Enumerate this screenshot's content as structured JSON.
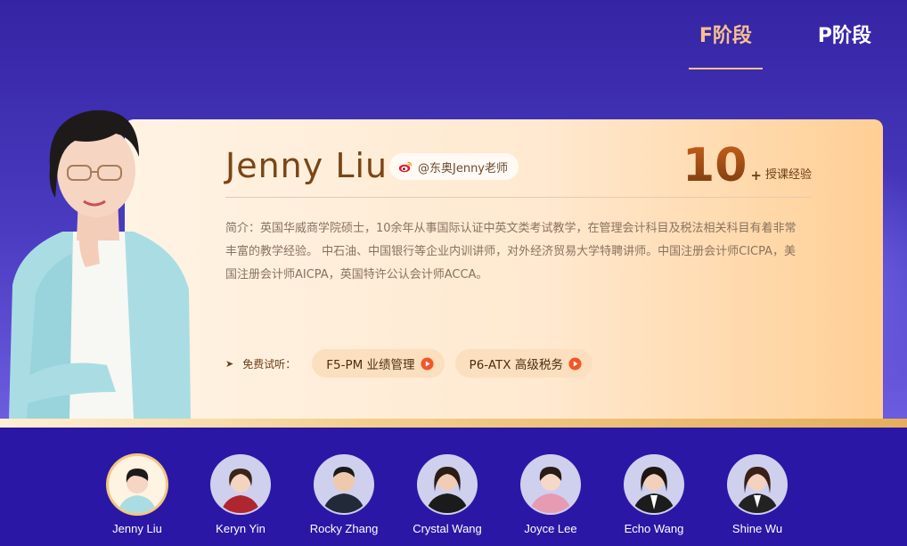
{
  "tabs": [
    {
      "label": "F阶段",
      "active": true
    },
    {
      "label": "P阶段",
      "active": false
    }
  ],
  "teacher": {
    "name": "Jenny Liu",
    "weibo": "@东奥Jenny老师",
    "experience_number": "10",
    "experience_plus": "+",
    "experience_label": "授课经验",
    "intro": "简介：英国华威商学院硕士，10余年从事国际认证中英文类考试教学，在管理会计科目及税法相关科目有着非常丰富的教学经验。 中石油、中国银行等企业内训讲师，对外经济贸易大学特聘讲师。中国注册会计师CICPA，美国注册会计师AICPA，英国特许公认会计师ACCA。",
    "trial_label": "免费试听：",
    "trial_courses": [
      {
        "label": "F5-PM 业绩管理"
      },
      {
        "label": "P6-ATX 高级税务"
      }
    ]
  },
  "teachers": [
    {
      "name": "Jenny Liu",
      "active": true
    },
    {
      "name": "Keryn Yin",
      "active": false
    },
    {
      "name": "Rocky Zhang",
      "active": false
    },
    {
      "name": "Crystal Wang",
      "active": false
    },
    {
      "name": "Joyce Lee",
      "active": false
    },
    {
      "name": "Echo Wang",
      "active": false
    },
    {
      "name": "Shine Wu",
      "active": false
    }
  ],
  "colors": {
    "accent": "#f5c08f",
    "brand_purple": "#2b17a6",
    "card_gradient_end": "#ffcf95",
    "play_icon": "#f0572b"
  },
  "icons": {
    "weibo": "weibo-icon",
    "play": "play-icon",
    "arrow": "arrow-right-icon"
  }
}
